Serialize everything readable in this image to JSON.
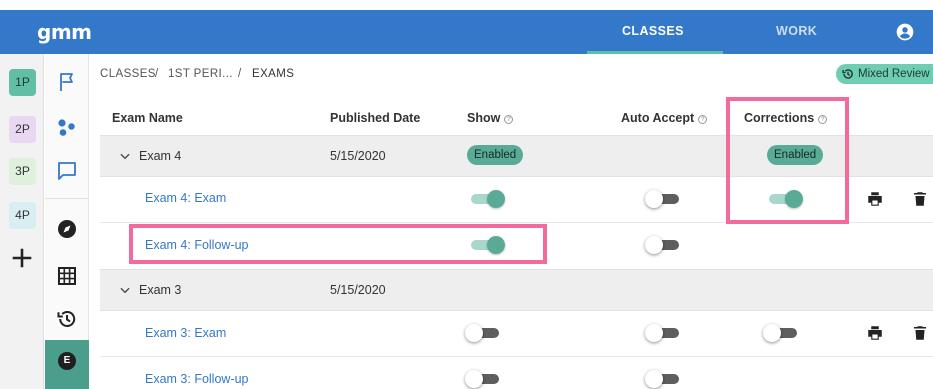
{
  "app": {
    "logo": "gmm",
    "nav_tabs": [
      {
        "label": "CLASSES",
        "active": true
      },
      {
        "label": "WORK",
        "active": false
      }
    ],
    "user_icon": "account-circle-icon"
  },
  "periods": {
    "items": [
      {
        "label": "1P",
        "color": "#62bfa6"
      },
      {
        "label": "2P",
        "color": "#e8d8f1"
      },
      {
        "label": "3P",
        "color": "#dff0dc"
      },
      {
        "label": "4P",
        "color": "#d9eef2"
      }
    ],
    "add_icon": "plus-icon"
  },
  "icon_sidebar": [
    {
      "icon": "flag-icon"
    },
    {
      "icon": "groups-icon"
    },
    {
      "icon": "chat-icon"
    },
    {
      "icon": "compass-icon"
    },
    {
      "icon": "grid-icon"
    },
    {
      "icon": "history-icon"
    },
    {
      "icon": "exam-icon",
      "label": "E",
      "active": true
    }
  ],
  "breadcrumb": {
    "items": [
      "CLASSES",
      "1ST PERI...",
      "EXAMS"
    ],
    "separator": "/"
  },
  "mixed_review": {
    "label": "Mixed Review",
    "icon": "history-icon"
  },
  "table": {
    "headers": {
      "name": "Exam Name",
      "date": "Published Date",
      "show": "Show",
      "auto_accept": "Auto Accept",
      "corrections": "Corrections",
      "help_glyph": "?"
    },
    "groups": [
      {
        "name": "Exam 4",
        "date": "5/15/2020",
        "show_badge": "Enabled",
        "corrections_badge": "Enabled",
        "rows": [
          {
            "name": "Exam 4: Exam",
            "show": true,
            "auto_accept": false,
            "corrections": true,
            "actions": [
              "print-icon",
              "trash-icon"
            ]
          },
          {
            "name": "Exam 4: Follow-up",
            "show": true,
            "auto_accept": false
          }
        ]
      },
      {
        "name": "Exam 3",
        "date": "5/15/2020",
        "rows": [
          {
            "name": "Exam 3: Exam",
            "show": false,
            "auto_accept": false,
            "corrections": false,
            "actions": [
              "print-icon",
              "trash-icon"
            ]
          },
          {
            "name": "Exam 3: Follow-up",
            "show": false,
            "auto_accept": false
          }
        ]
      }
    ]
  },
  "colors": {
    "topbar": "#3478c9",
    "accent": "#5aaa98",
    "link": "#3478c9",
    "highlight": "#f36b9c"
  }
}
